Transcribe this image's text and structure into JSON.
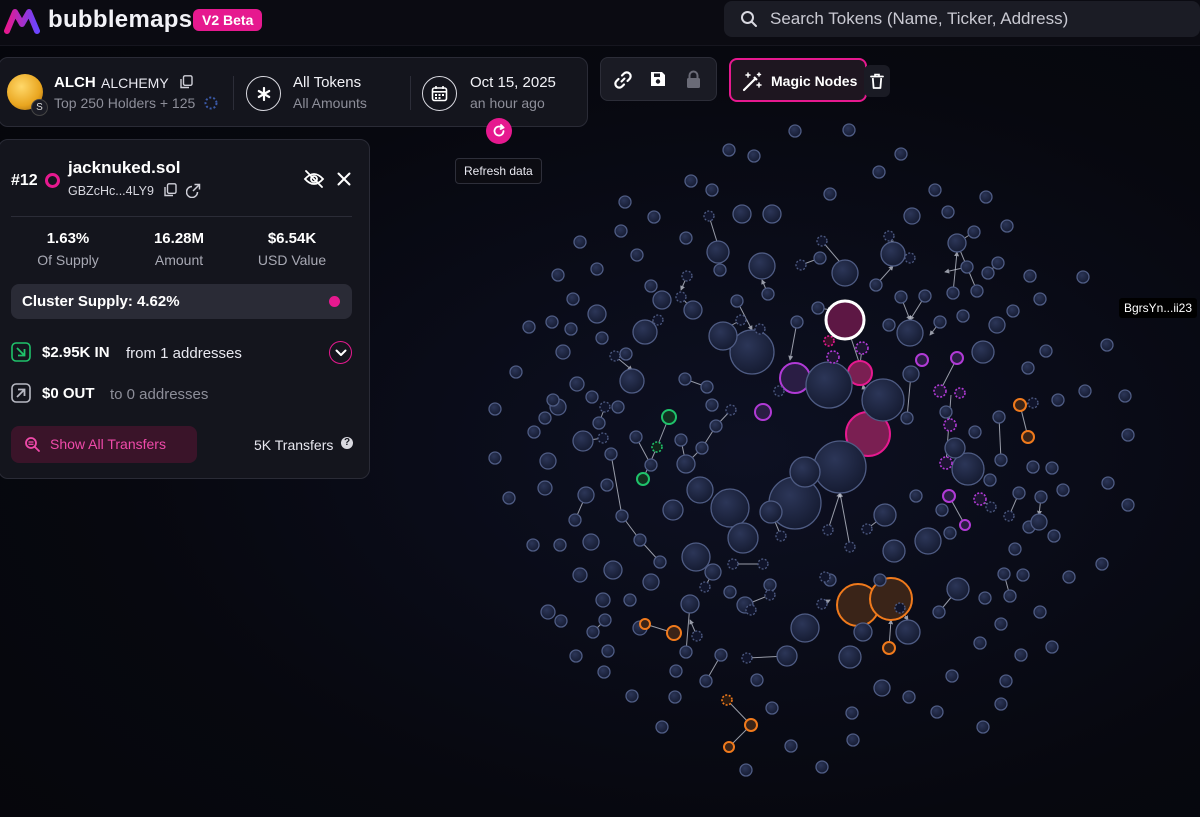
{
  "app": {
    "name": "bubblemaps",
    "badge": "V2 Beta",
    "search_placeholder": "Search Tokens (Name, Ticker, Address)"
  },
  "token": {
    "symbol": "ALCH",
    "name": "ALCHEMY",
    "holders": "Top 250 Holders + 125",
    "avatar_badge": "S",
    "filter_title": "All Tokens",
    "filter_sub": "All Amounts",
    "date": "Oct 15, 2025",
    "date_sub": "an hour ago",
    "refresh_tooltip": "Refresh data"
  },
  "toolbar": {
    "magic_label": "Magic Nodes"
  },
  "wallet": {
    "rank": "#12",
    "name": "jacknuked.sol",
    "address": "GBZcHc...4LY9",
    "stats": [
      {
        "value": "1.63%",
        "label": "Of Supply"
      },
      {
        "value": "16.28M",
        "label": "Amount"
      },
      {
        "value": "$6.54K",
        "label": "USD Value"
      }
    ],
    "cluster": "Cluster Supply: 4.62%",
    "in_amount": "$2.95K IN",
    "in_from": "from 1 addresses",
    "out_amount": "$0 OUT",
    "out_to": "to 0 addresses",
    "show_all": "Show All Transfers",
    "transfers": "5K Transfers"
  },
  "graph": {
    "hover_label": "BgrsYn...ii23",
    "colors": {
      "default": "#1d2542",
      "default_stroke": "#4f5c84",
      "pink": "#e6198f",
      "purple": "#b13ad6",
      "orange": "#f07a1c",
      "green": "#1fc26b",
      "selected": "#ffffff"
    }
  }
}
